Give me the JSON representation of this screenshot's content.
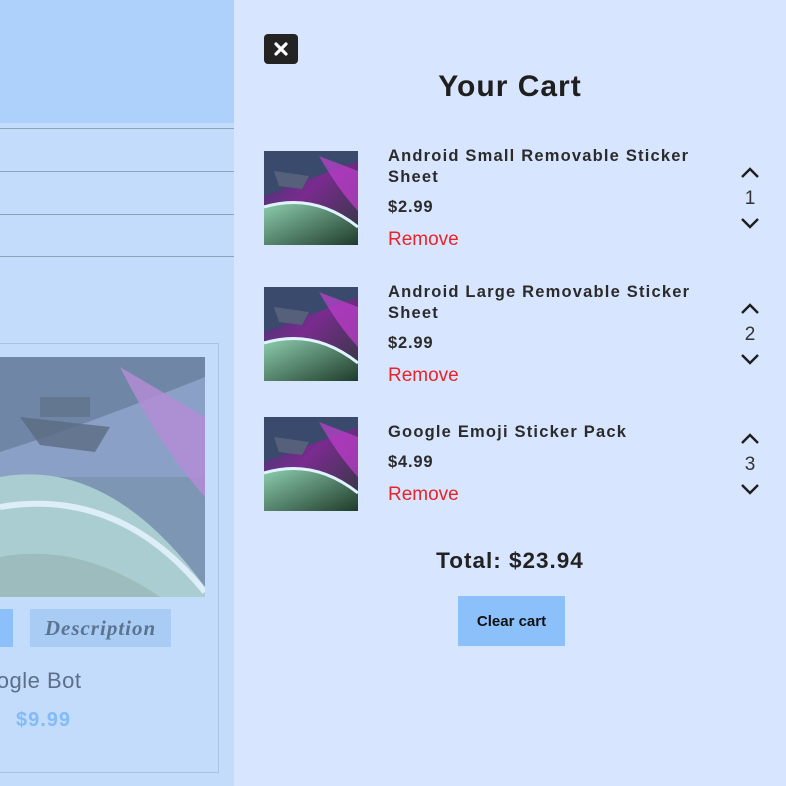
{
  "background_page": {
    "product_tag_label": "Description",
    "product_name": "oogle Bot",
    "product_price": "$9.99"
  },
  "cart": {
    "title": "Your Cart",
    "close_icon": "close-icon",
    "items": [
      {
        "name": "Android Small Removable Sticker Sheet",
        "price": "$2.99",
        "remove_label": "Remove",
        "quantity": "1"
      },
      {
        "name": "Android Large Removable Sticker Sheet",
        "price": "$2.99",
        "remove_label": "Remove",
        "quantity": "2"
      },
      {
        "name": "Google Emoji Sticker Pack",
        "price": "$4.99",
        "remove_label": "Remove",
        "quantity": "3"
      }
    ],
    "total_label": "Total: $23.94",
    "clear_label": "Clear cart"
  },
  "colors": {
    "panel_bg": "#d7e6fe",
    "remove": "#e8232a",
    "clear_button": "#8cc0fa",
    "close_button": "#232323"
  }
}
